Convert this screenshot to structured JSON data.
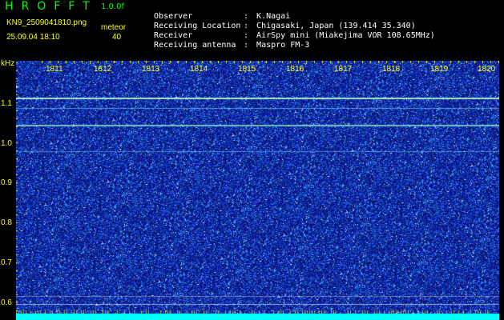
{
  "app": {
    "title": "HROFFT",
    "version": "1.0.0f"
  },
  "file_name": "KN9_2509041810.png",
  "datetime": "25.09.04 18:10",
  "meteor": {
    "label": "meteor",
    "count": "40"
  },
  "info": [
    {
      "key": "Observer",
      "value": "K.Nagai"
    },
    {
      "key": "Receiving Location",
      "value": "Chigasaki, Japan (139.414 35.340)"
    },
    {
      "key": "Receiver",
      "value": "AirSpy mini (Miakejima VOR 108.65MHz)"
    },
    {
      "key": "Receiving antenna",
      "value": "Maspro FM-3"
    }
  ],
  "axis": {
    "y_unit": "kHz",
    "y_ticks": [
      "1.1",
      "1.0",
      "0.9",
      "0.8",
      "0.7",
      "0.6"
    ],
    "x_ticks": [
      "1811",
      "1812",
      "1813",
      "1814",
      "1815",
      "1816",
      "1817",
      "1818",
      "1819",
      "1820"
    ]
  },
  "colors": {
    "background": "#000000",
    "label": "#ffff00",
    "title": "#00ff00",
    "noise_base": "#0a1a6e",
    "bottom_band": "#00ffff"
  }
}
